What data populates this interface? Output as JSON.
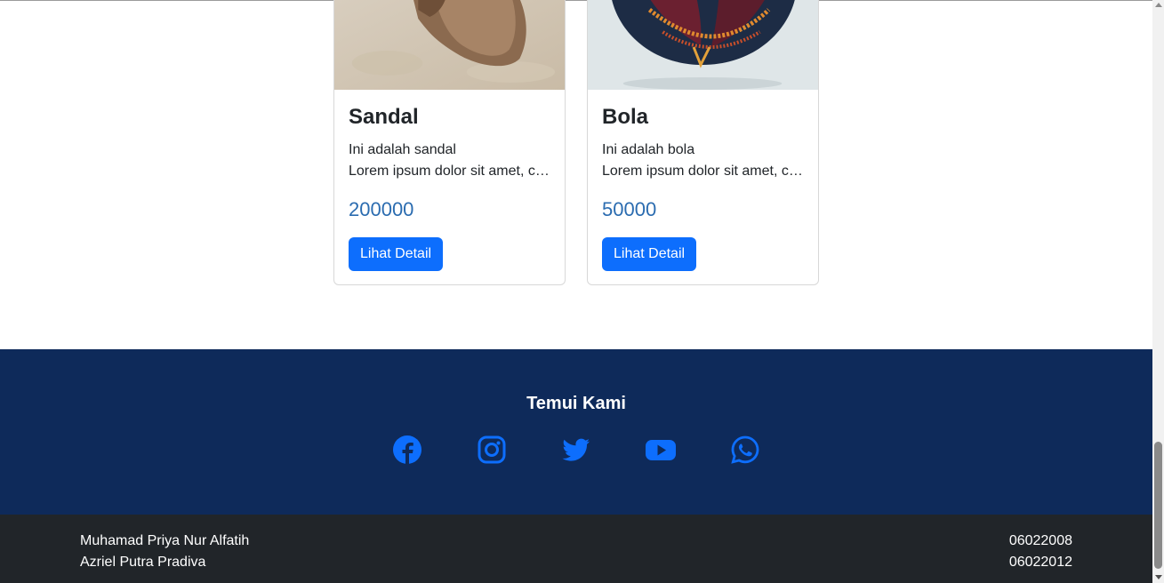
{
  "products": [
    {
      "name": "Sandal",
      "desc": "Ini adalah sandal",
      "lorem": "Lorem ipsum dolor sit amet, consectetur adipiscing elit.",
      "price": "200000",
      "button": "Lihat Detail"
    },
    {
      "name": "Bola",
      "desc": "Ini adalah bola",
      "lorem": "Lorem ipsum dolor sit amet, consectetur adipiscing elit.",
      "price": "50000",
      "button": "Lihat Detail"
    }
  ],
  "contact": {
    "title": "Temui Kami",
    "icons": [
      "facebook-icon",
      "instagram-icon",
      "twitter-icon",
      "youtube-icon",
      "whatsapp-icon"
    ],
    "icon_color": "#0d6efd",
    "background": "#0e2a5a"
  },
  "footer": {
    "members": [
      {
        "name": "Muhamad Priya Nur Alfatih",
        "id": "06022008"
      },
      {
        "name": "Azriel Putra Pradiva",
        "id": "06022012"
      }
    ],
    "background": "#212529"
  }
}
